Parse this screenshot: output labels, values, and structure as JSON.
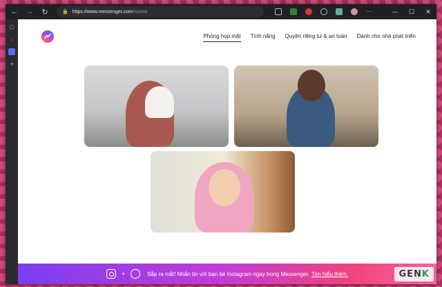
{
  "browser": {
    "url_host": "https://www.messenger.com",
    "url_path": "/rooms",
    "window_controls": [
      "minimize-icon",
      "maximize-icon",
      "close-icon"
    ]
  },
  "nav": {
    "items": [
      {
        "label": "Phòng họp mặt",
        "active": true
      },
      {
        "label": "Tính năng",
        "active": false
      },
      {
        "label": "Quyền riêng tư & an toàn",
        "active": false
      },
      {
        "label": "Dành cho nhà phát triển",
        "active": false
      }
    ]
  },
  "banner": {
    "text": "Sắp ra mắt! Nhắn tin với bạn bè Instagram ngay trong Messenger.",
    "link": "Tìm hiểu thêm.",
    "plus": "+"
  },
  "watermark": {
    "text_main": "GEN",
    "text_accent": "K"
  },
  "colors": {
    "banner_start": "#7b3ff2",
    "banner_end": "#f5639a",
    "titlebar": "#202124"
  }
}
